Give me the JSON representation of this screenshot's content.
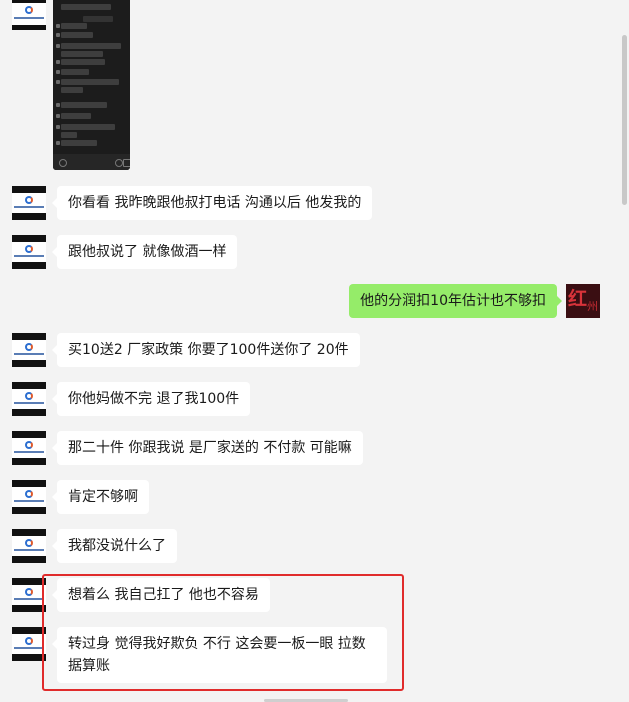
{
  "chat": {
    "messages": [
      {
        "side": "other",
        "text": "你看看 我昨晚跟他叔打电话 沟通以后 他发我的"
      },
      {
        "side": "other",
        "text": "跟他叔说了 就像做酒一样"
      },
      {
        "side": "self",
        "text": "他的分润扣10年估计也不够扣"
      },
      {
        "side": "other",
        "text": "买10送2 厂家政策 你要了100件送你了 20件"
      },
      {
        "side": "other",
        "text": "你他妈做不完 退了我100件"
      },
      {
        "side": "other",
        "text": "那二十件 你跟我说 是厂家送的 不付款 可能嘛"
      },
      {
        "side": "other",
        "text": "肯定不够啊"
      },
      {
        "side": "other",
        "text": "我都没说什么了"
      },
      {
        "side": "other",
        "text": "想着么 我自己扛了 他也不容易"
      },
      {
        "side": "other",
        "text": "转过身 觉得我好欺负 不行 这会要一板一眼 拉数据算账"
      }
    ]
  },
  "colors": {
    "background": "#f3f3f3",
    "bubble_other": "#ffffff",
    "bubble_self": "#95ec69",
    "highlight_border": "#e02b2b"
  }
}
